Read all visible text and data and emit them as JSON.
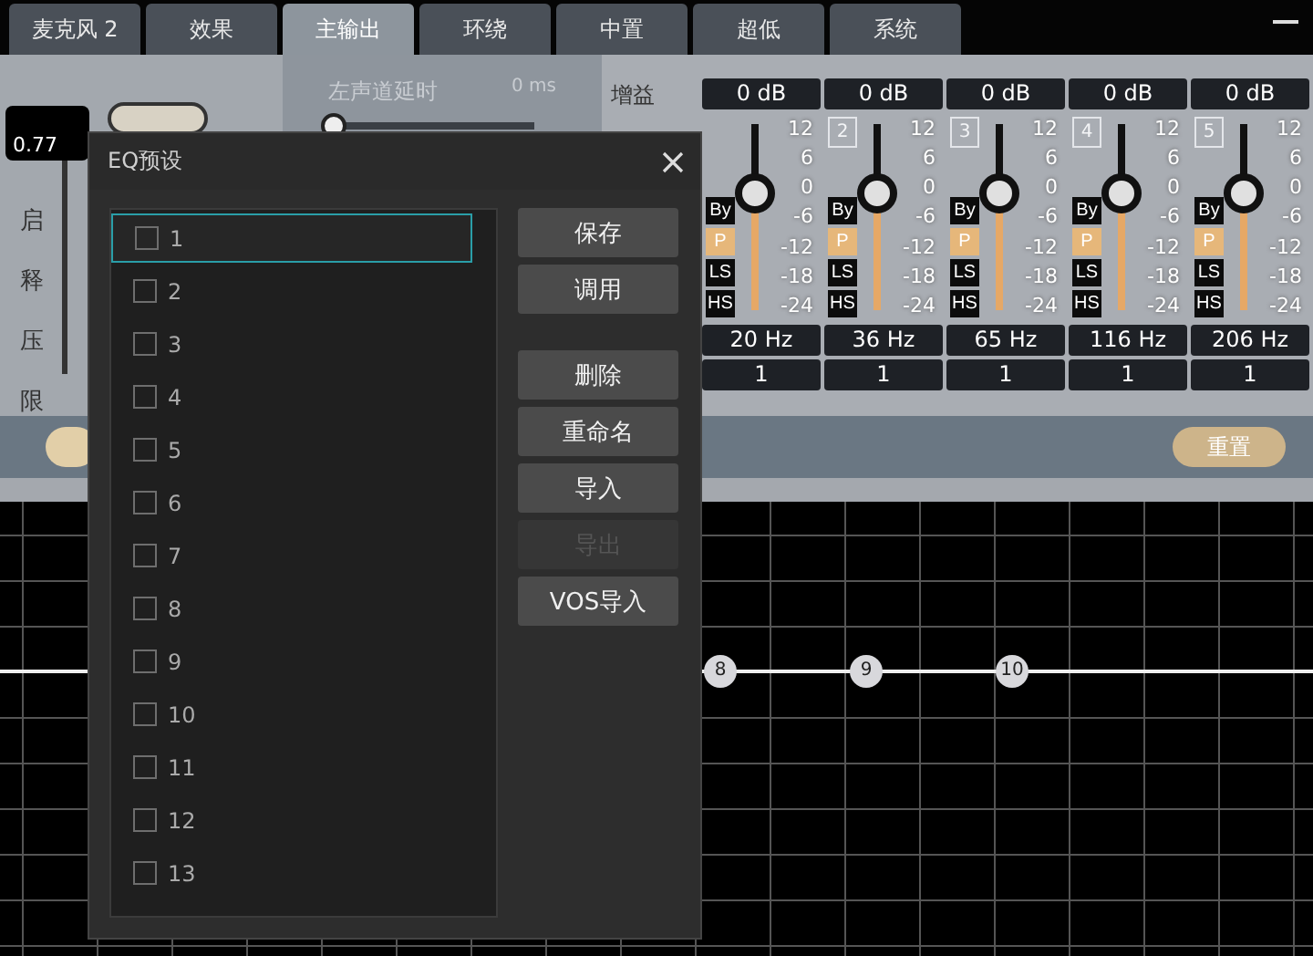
{
  "tabs": [
    {
      "label": "麦克风 2",
      "selected": false
    },
    {
      "label": "效果",
      "selected": false
    },
    {
      "label": "主输出",
      "selected": true
    },
    {
      "label": "环绕",
      "selected": false
    },
    {
      "label": "中置",
      "selected": false
    },
    {
      "label": "超低",
      "selected": false
    },
    {
      "label": "系统",
      "selected": false
    }
  ],
  "left_panel": {
    "readout": "0.77",
    "labels": [
      "启",
      "释",
      "压",
      "限"
    ]
  },
  "delay": {
    "label": "左声道延时",
    "reading": "0 ms",
    "level": 0
  },
  "gain_label": "增益",
  "channels": [
    {
      "gain": "0 dB",
      "level": 0.667,
      "scale": [
        "12",
        "6",
        "0",
        "-6",
        "-12",
        "-18",
        "-24"
      ],
      "filters": [
        {
          "label": "By",
          "selected": false
        },
        {
          "label": "P",
          "selected": true
        },
        {
          "label": "LS",
          "selected": false
        },
        {
          "label": "HS",
          "selected": false
        }
      ],
      "freq": "20 Hz",
      "q": "1"
    },
    {
      "gain": "0 dB",
      "index": "2",
      "level": 0.667,
      "scale": [
        "12",
        "6",
        "0",
        "-6",
        "-12",
        "-18",
        "-24"
      ],
      "filters": [
        {
          "label": "By",
          "selected": false
        },
        {
          "label": "P",
          "selected": true
        },
        {
          "label": "LS",
          "selected": false
        },
        {
          "label": "HS",
          "selected": false
        }
      ],
      "freq": "36 Hz",
      "q": "1"
    },
    {
      "gain": "0 dB",
      "index": "3",
      "level": 0.667,
      "scale": [
        "12",
        "6",
        "0",
        "-6",
        "-12",
        "-18",
        "-24"
      ],
      "filters": [
        {
          "label": "By",
          "selected": false
        },
        {
          "label": "P",
          "selected": true
        },
        {
          "label": "LS",
          "selected": false
        },
        {
          "label": "HS",
          "selected": false
        }
      ],
      "freq": "65 Hz",
      "q": "1"
    },
    {
      "gain": "0 dB",
      "index": "4",
      "level": 0.667,
      "scale": [
        "12",
        "6",
        "0",
        "-6",
        "-12",
        "-18",
        "-24"
      ],
      "filters": [
        {
          "label": "By",
          "selected": false
        },
        {
          "label": "P",
          "selected": true
        },
        {
          "label": "LS",
          "selected": false
        },
        {
          "label": "HS",
          "selected": false
        }
      ],
      "freq": "116 Hz",
      "q": "1"
    },
    {
      "gain": "0 dB",
      "index": "5",
      "level": 0.667,
      "scale": [
        "12",
        "6",
        "0",
        "-6",
        "-12",
        "-18",
        "-24"
      ],
      "filters": [
        {
          "label": "By",
          "selected": false
        },
        {
          "label": "P",
          "selected": true
        },
        {
          "label": "LS",
          "selected": false
        },
        {
          "label": "HS",
          "selected": false
        }
      ],
      "freq": "206 Hz",
      "q": "1"
    }
  ],
  "reset_button": "重置",
  "graph": {
    "nodes": [
      "8",
      "9",
      "10"
    ]
  },
  "dialog": {
    "title": "EQ预设",
    "presets": [
      {
        "label": "1",
        "checked": false,
        "selected": true
      },
      {
        "label": "2",
        "checked": false,
        "selected": false
      },
      {
        "label": "3",
        "checked": false,
        "selected": false
      },
      {
        "label": "4",
        "checked": false,
        "selected": false
      },
      {
        "label": "5",
        "checked": false,
        "selected": false
      },
      {
        "label": "6",
        "checked": false,
        "selected": false
      },
      {
        "label": "7",
        "checked": false,
        "selected": false
      },
      {
        "label": "8",
        "checked": false,
        "selected": false
      },
      {
        "label": "9",
        "checked": false,
        "selected": false
      },
      {
        "label": "10",
        "checked": false,
        "selected": false
      },
      {
        "label": "11",
        "checked": false,
        "selected": false
      },
      {
        "label": "12",
        "checked": false,
        "selected": false
      },
      {
        "label": "13",
        "checked": false,
        "selected": false
      }
    ],
    "button_groups": [
      [
        {
          "label": "保存",
          "disabled": false
        },
        {
          "label": "调用",
          "disabled": false
        }
      ],
      [
        {
          "label": "删除",
          "disabled": false
        },
        {
          "label": "重命名",
          "disabled": false
        },
        {
          "label": "导入",
          "disabled": false
        },
        {
          "label": "导出",
          "disabled": true
        },
        {
          "label": "VOS导入",
          "disabled": false
        }
      ]
    ]
  }
}
